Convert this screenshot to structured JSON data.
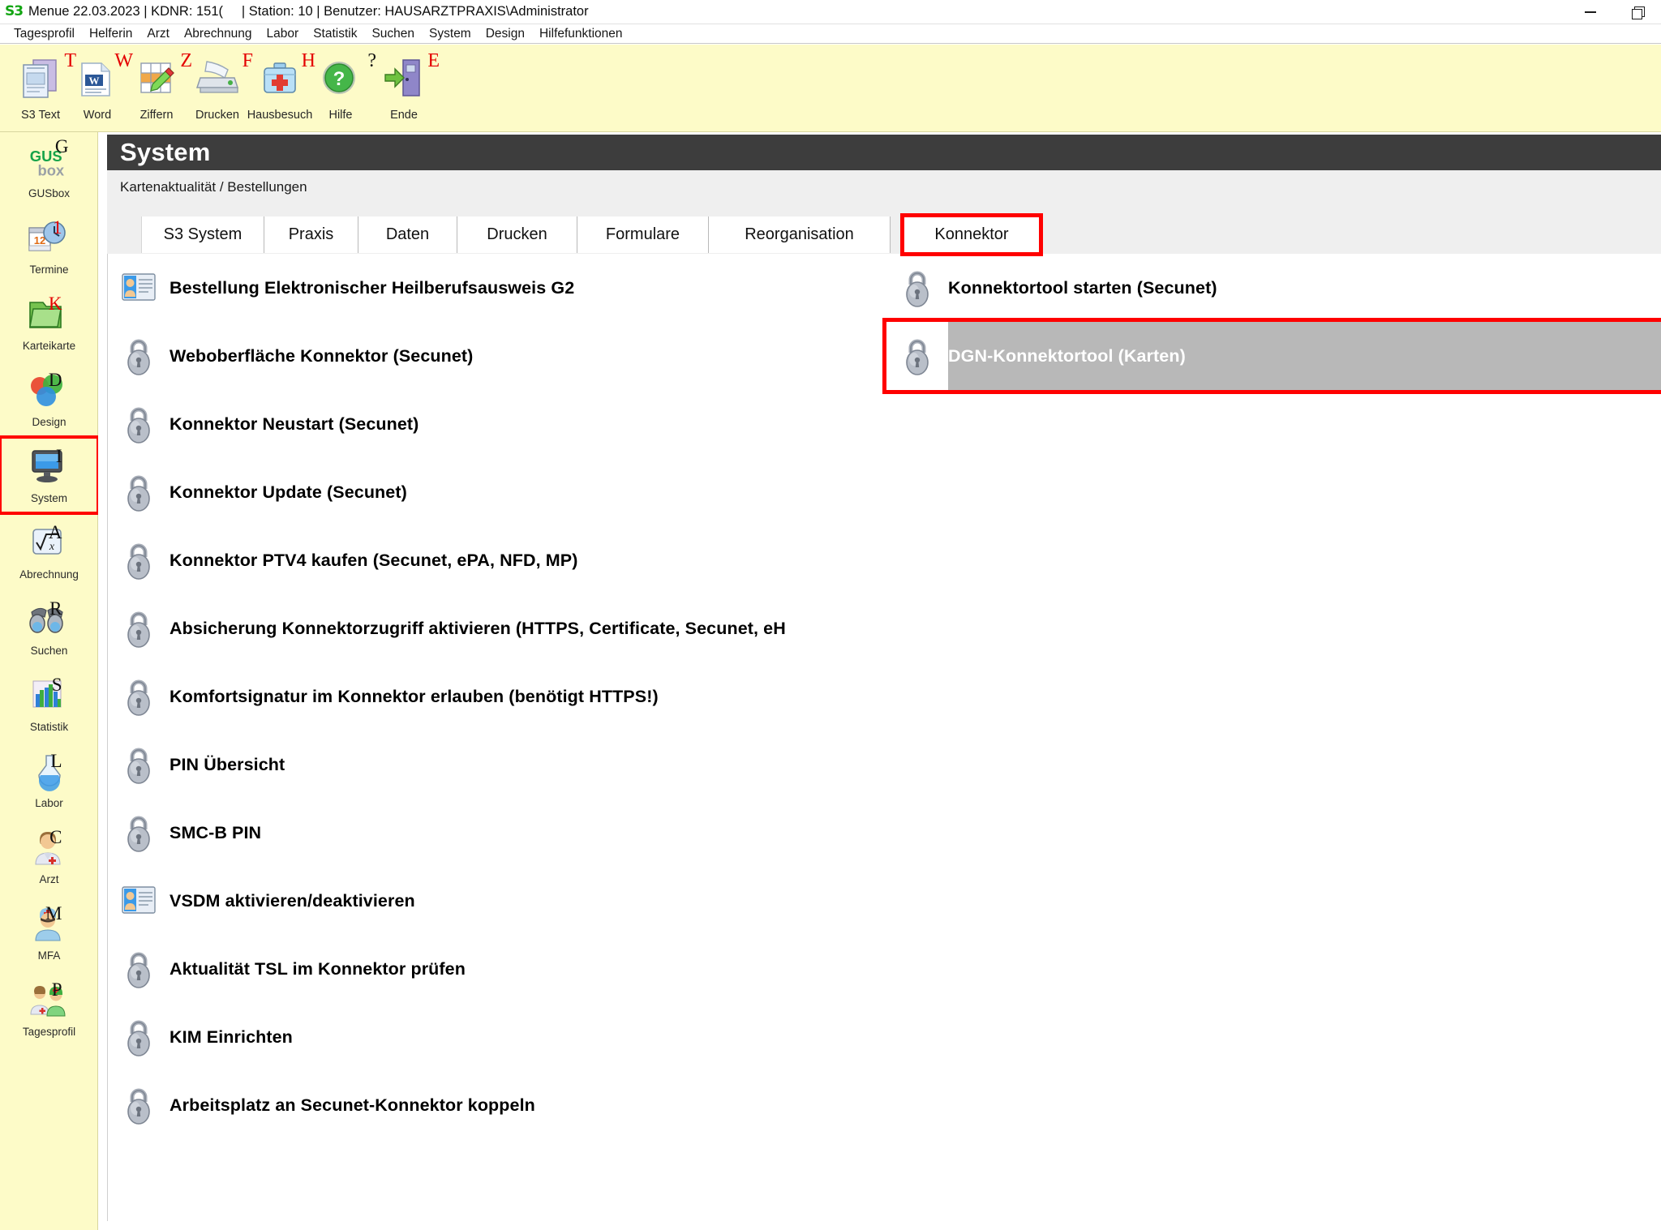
{
  "window": {
    "logo_text": "S3",
    "title": "Menue 22.03.2023 | KDNR: 151(     | Station: 10 | Benutzer: HAUSARZTPRAXIS\\Administrator",
    "controls": [
      {
        "name": "minimize-button",
        "icon": "minimize-icon"
      },
      {
        "name": "restore-button",
        "icon": "restore-icon"
      }
    ]
  },
  "menubar": {
    "items": [
      {
        "label": "Tagesprofil"
      },
      {
        "label": "Helferin"
      },
      {
        "label": "Arzt"
      },
      {
        "label": "Abrechnung"
      },
      {
        "label": "Labor"
      },
      {
        "label": "Statistik"
      },
      {
        "label": "Suchen"
      },
      {
        "label": "System"
      },
      {
        "label": "Design"
      },
      {
        "label": "Hilfefunktionen"
      }
    ]
  },
  "toolbar": {
    "items": [
      {
        "label": "S3 Text",
        "hotkey": "T",
        "icon": "documents-icon",
        "hotkey_color": "red"
      },
      {
        "label": "Word",
        "hotkey": "W",
        "icon": "word-icon",
        "hotkey_color": "red"
      },
      {
        "label": "Ziffern",
        "hotkey": "Z",
        "icon": "grid-pencil-icon",
        "hotkey_color": "red"
      },
      {
        "label": "Drucken",
        "hotkey": "F",
        "icon": "printer-icon",
        "hotkey_color": "red"
      },
      {
        "label": "Hausbesuch",
        "hotkey": "H",
        "icon": "medkit-icon",
        "hotkey_color": "red"
      },
      {
        "label": "Hilfe",
        "hotkey": "?",
        "icon": "help-icon",
        "hotkey_color": "dark"
      },
      {
        "label": "Ende",
        "hotkey": "E",
        "icon": "exit-door-icon",
        "hotkey_color": "red"
      }
    ]
  },
  "sidebar": {
    "items": [
      {
        "label": "GUSbox",
        "hotkey": "G",
        "icon": "gusbox-icon",
        "hotkey_color": "dark",
        "selected": false
      },
      {
        "label": "Termine",
        "hotkey": "1",
        "icon": "calendar-clock-icon",
        "hotkey_color": "red",
        "selected": false
      },
      {
        "label": "Karteikarte",
        "hotkey": "K",
        "icon": "folder-icon",
        "hotkey_color": "red",
        "selected": false
      },
      {
        "label": "Design",
        "hotkey": "D",
        "icon": "venn-circles-icon",
        "hotkey_color": "dark",
        "selected": false
      },
      {
        "label": "System",
        "hotkey": "I",
        "icon": "monitor-icon",
        "hotkey_color": "dark",
        "selected": true
      },
      {
        "label": "Abrechnung",
        "hotkey": "A",
        "icon": "sqrt-icon",
        "hotkey_color": "dark",
        "selected": false
      },
      {
        "label": "Suchen",
        "hotkey": "R",
        "icon": "binoculars-icon",
        "hotkey_color": "dark",
        "selected": false
      },
      {
        "label": "Statistik",
        "hotkey": "S",
        "icon": "barchart-icon",
        "hotkey_color": "dark",
        "selected": false
      },
      {
        "label": "Labor",
        "hotkey": "L",
        "icon": "flask-icon",
        "hotkey_color": "dark",
        "selected": false
      },
      {
        "label": "Arzt",
        "hotkey": "C",
        "icon": "doctor-icon",
        "hotkey_color": "dark",
        "selected": false
      },
      {
        "label": "MFA",
        "hotkey": "M",
        "icon": "nurse-icon",
        "hotkey_color": "dark",
        "selected": false
      },
      {
        "label": "Tagesprofil",
        "hotkey": "P",
        "icon": "two-people-icon",
        "hotkey_color": "dark",
        "selected": false
      }
    ]
  },
  "panel": {
    "title": "System",
    "breadcrumb": "Kartenaktualität / Bestellungen",
    "tabs": [
      {
        "label": "S3 System",
        "active": false,
        "marked": false
      },
      {
        "label": "Praxis",
        "active": false,
        "marked": false
      },
      {
        "label": "Daten",
        "active": false,
        "marked": false
      },
      {
        "label": "Drucken",
        "active": false,
        "marked": false
      },
      {
        "label": "Formulare",
        "active": false,
        "marked": false
      },
      {
        "label": "Reorganisation",
        "active": false,
        "marked": false
      },
      {
        "label": "Konnektor",
        "active": true,
        "marked": true
      }
    ]
  },
  "content": {
    "left_column": [
      {
        "label": "Bestellung Elektronischer Heilberufsausweis G2",
        "icon": "id-card-icon",
        "selected": false,
        "marked": false
      },
      {
        "label": "Weboberfläche Konnektor (Secunet)",
        "icon": "padlock-icon",
        "selected": false,
        "marked": false
      },
      {
        "label": "Konnektor Neustart (Secunet)",
        "icon": "padlock-icon",
        "selected": false,
        "marked": false
      },
      {
        "label": "Konnektor Update (Secunet)",
        "icon": "padlock-icon",
        "selected": false,
        "marked": false
      },
      {
        "label": "Konnektor PTV4 kaufen (Secunet, ePA, NFD, MP)",
        "icon": "padlock-icon",
        "selected": false,
        "marked": false
      },
      {
        "label": "Absicherung Konnektorzugriff aktivieren (HTTPS, Certificate, Secunet, eH",
        "icon": "padlock-icon",
        "selected": false,
        "marked": false
      },
      {
        "label": "Komfortsignatur im Konnektor erlauben (benötigt HTTPS!)",
        "icon": "padlock-icon",
        "selected": false,
        "marked": false
      },
      {
        "label": "PIN Übersicht",
        "icon": "padlock-icon",
        "selected": false,
        "marked": false
      },
      {
        "label": "SMC-B PIN",
        "icon": "padlock-icon",
        "selected": false,
        "marked": false
      },
      {
        "label": "VSDM aktivieren/deaktivieren",
        "icon": "id-card-icon",
        "selected": false,
        "marked": false
      },
      {
        "label": "Aktualität TSL im Konnektor prüfen",
        "icon": "padlock-icon",
        "selected": false,
        "marked": false
      },
      {
        "label": "KIM Einrichten",
        "icon": "padlock-icon",
        "selected": false,
        "marked": false
      },
      {
        "label": "Arbeitsplatz an Secunet-Konnektor koppeln",
        "icon": "padlock-icon",
        "selected": false,
        "marked": false
      }
    ],
    "right_column": [
      {
        "label": "Konnektortool starten (Secunet)",
        "icon": "padlock-icon",
        "selected": false,
        "marked": false
      },
      {
        "label": "DGN-Konnektortool (Karten)",
        "icon": "padlock-icon",
        "selected": true,
        "marked": true
      }
    ]
  },
  "colors": {
    "toolbar_yellow": "#fdfbc8",
    "panel_header_dark": "#3d3d3d",
    "breadcrumb_gray": "#efefef",
    "annotation_red": "#ff0000",
    "selection_gray": "#b8b8b8",
    "hotkey_red": "#e40000"
  }
}
